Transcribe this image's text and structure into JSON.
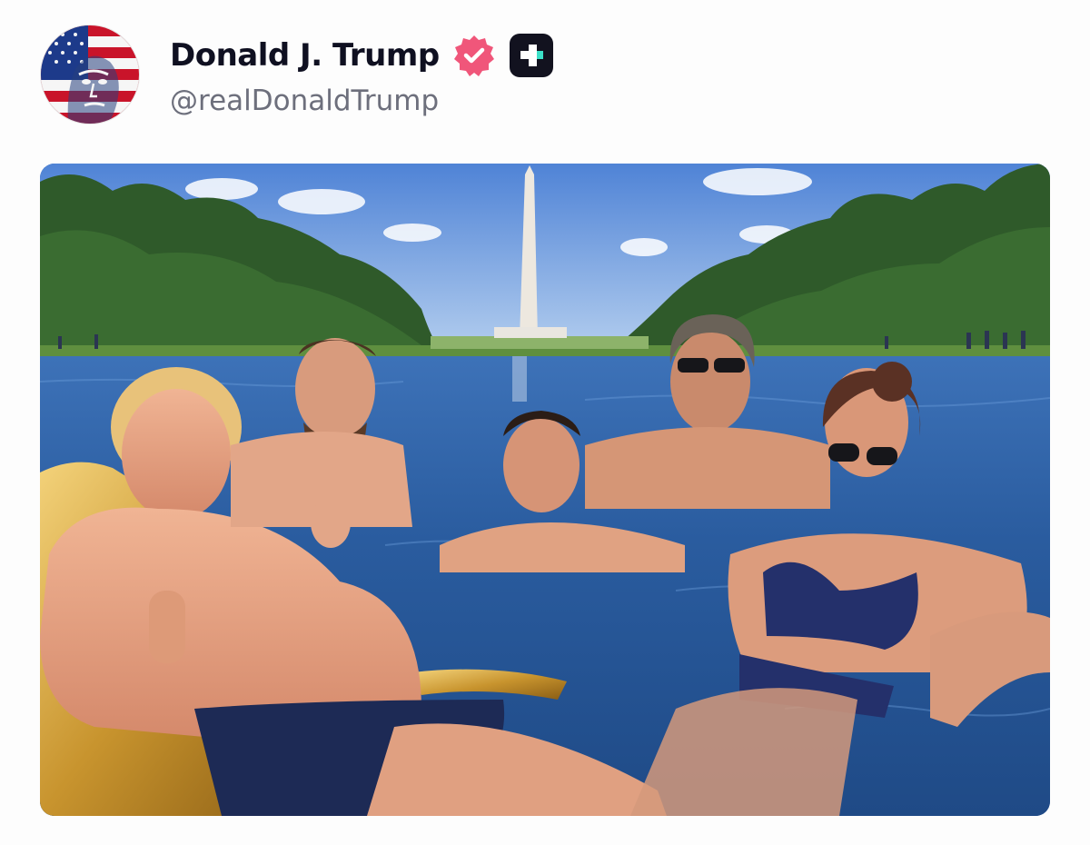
{
  "post": {
    "author": {
      "display_name": "Donald J. Trump",
      "handle": "@realDonaldTrump",
      "avatar_icon": "avatar-flag-portrait",
      "verified_icon": "verified-badge-icon",
      "app_icon": "truth-social-app-icon"
    },
    "media": {
      "kind": "photo",
      "subject": "poolside-photo"
    }
  },
  "colors": {
    "verified_pink": "#f0567a",
    "app_badge_bg": "#12121f",
    "app_badge_accent": "#3ce0c8",
    "name_text": "#0f1021",
    "handle_text": "#6d6f7c"
  }
}
